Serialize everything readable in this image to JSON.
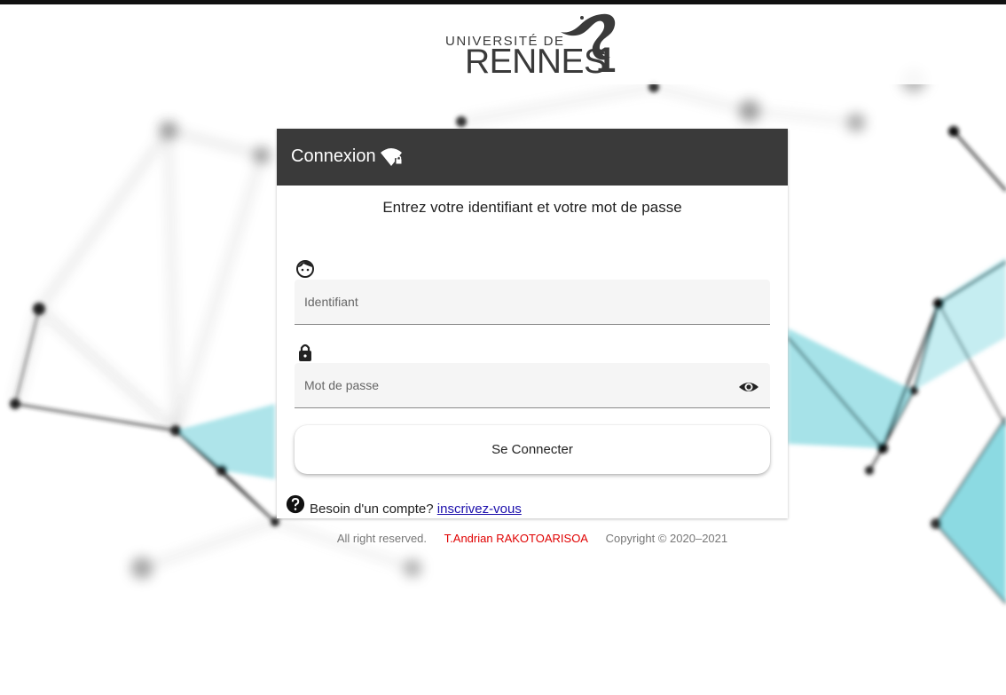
{
  "logo": {
    "line1": "UNIVERSITÉ DE",
    "line2": "RENNES",
    "number": "1"
  },
  "login_card": {
    "title": "Connexion",
    "title_icon": "wifi-lock-icon",
    "subtitle": "Entrez votre identifiant et votre mot de passe",
    "username": {
      "icon": "face-icon",
      "placeholder": "Identifiant",
      "value": ""
    },
    "password": {
      "icon": "lock-icon",
      "placeholder": "Mot de passe",
      "value": "",
      "toggle_icon": "eye-icon"
    },
    "submit_label": "Se Connecter",
    "help": {
      "icon": "help-circle-icon",
      "text": "Besoin d'un compte?",
      "link": "inscrivez-vous"
    }
  },
  "footer": {
    "rights": "All right reserved.",
    "author": "T.Andrian RAKOTOARISOA",
    "copyright": "Copyright © 2020–2021"
  },
  "colors": {
    "header_bg": "#3a3a3a",
    "accent_teal": "#5ccad6",
    "author_red": "#e00000",
    "link_blue": "#1a0dab"
  }
}
